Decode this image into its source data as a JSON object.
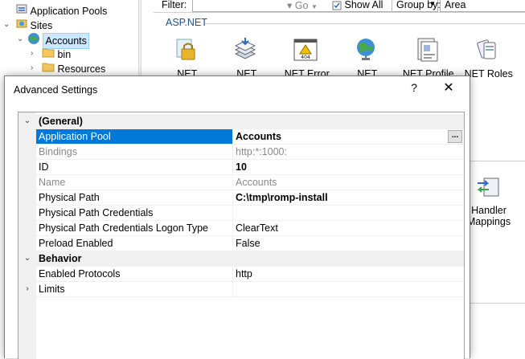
{
  "tree": {
    "items": [
      {
        "label": "Application Pools"
      },
      {
        "label": "Sites"
      },
      {
        "label": "Accounts"
      },
      {
        "label": "bin"
      },
      {
        "label": "Resources"
      }
    ]
  },
  "toolbar": {
    "filter_label": "Filter:",
    "filter_value": "",
    "go_label": "Go",
    "show_all_label": "Show All",
    "group_by_label": "Group by:",
    "group_by_value": "Area"
  },
  "features": {
    "section_title": "ASP.NET",
    "items": [
      {
        "label": ".NET",
        "icon": "lock-icon"
      },
      {
        "label": ".NET",
        "icon": "stack-icon"
      },
      {
        "label": ".NET Error",
        "icon": "error-page-icon"
      },
      {
        "label": ".NET",
        "icon": "globe-icon"
      },
      {
        "label": ".NET Profile",
        "icon": "profile-icon"
      },
      {
        "label": ".NET Roles",
        "icon": "roles-icon"
      }
    ],
    "handler": {
      "line1": "Handler",
      "line2": "Mappings",
      "icon": "handler-icon"
    }
  },
  "dialog": {
    "title": "Advanced Settings",
    "help_label": "?",
    "close_label": "✕",
    "categories": [
      {
        "name": "(General)",
        "expanded": true,
        "properties": [
          {
            "name": "Application Pool",
            "value": "Accounts",
            "selected": true,
            "bold": true,
            "has_button": true
          },
          {
            "name": "Bindings",
            "value": "http:*:1000:",
            "dim": true
          },
          {
            "name": "ID",
            "value": "10",
            "bold": true
          },
          {
            "name": "Name",
            "value": "Accounts",
            "dim": true
          },
          {
            "name": "Physical Path",
            "value": "C:\\tmp\\romp-install",
            "bold": true
          },
          {
            "name": "Physical Path Credentials",
            "value": ""
          },
          {
            "name": "Physical Path Credentials Logon Type",
            "value": "ClearText"
          },
          {
            "name": "Preload Enabled",
            "value": "False"
          }
        ]
      },
      {
        "name": "Behavior",
        "expanded": true,
        "properties": [
          {
            "name": "Enabled Protocols",
            "value": "http"
          },
          {
            "name": "Limits",
            "value": "",
            "collapsed_group": true
          }
        ]
      }
    ],
    "ellipsis_label": "..."
  },
  "colors": {
    "selection": "#0078d7",
    "category_bg": "#f0f0f0",
    "section_title": "#1e4e8c",
    "tree_selection": "#cce8ff"
  }
}
